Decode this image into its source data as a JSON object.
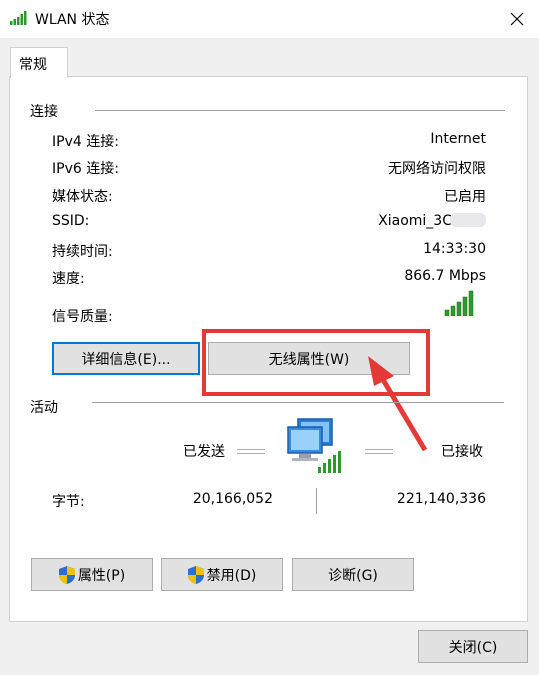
{
  "window": {
    "title": "WLAN 状态"
  },
  "tabs": [
    {
      "label": "常规"
    }
  ],
  "connection": {
    "section_title": "连接",
    "rows": [
      {
        "label": "IPv4 连接:",
        "value": "Internet"
      },
      {
        "label": "IPv6 连接:",
        "value": "无网络访问权限"
      },
      {
        "label": "媒体状态:",
        "value": "已启用"
      },
      {
        "label": "SSID:",
        "value": "Xiaomi_3C"
      },
      {
        "label": "持续时间:",
        "value": "14:33:30"
      },
      {
        "label": "速度:",
        "value": "866.7 Mbps"
      }
    ],
    "signal_label": "信号质量:",
    "details_button": "详细信息(E)...",
    "wireless_props_button": "无线属性(W)"
  },
  "activity": {
    "section_title": "活动",
    "sent_label": "已发送",
    "received_label": "已接收",
    "bytes_label": "字节:",
    "bytes_sent": "20,166,052",
    "bytes_received": "221,140,336"
  },
  "buttons": {
    "properties": "属性(P)",
    "disable": "禁用(D)",
    "diagnose": "诊断(G)",
    "close": "关闭(C)"
  },
  "colors": {
    "highlight": "#e53935",
    "signal": "#2e9a2e",
    "accent": "#0078d7"
  }
}
